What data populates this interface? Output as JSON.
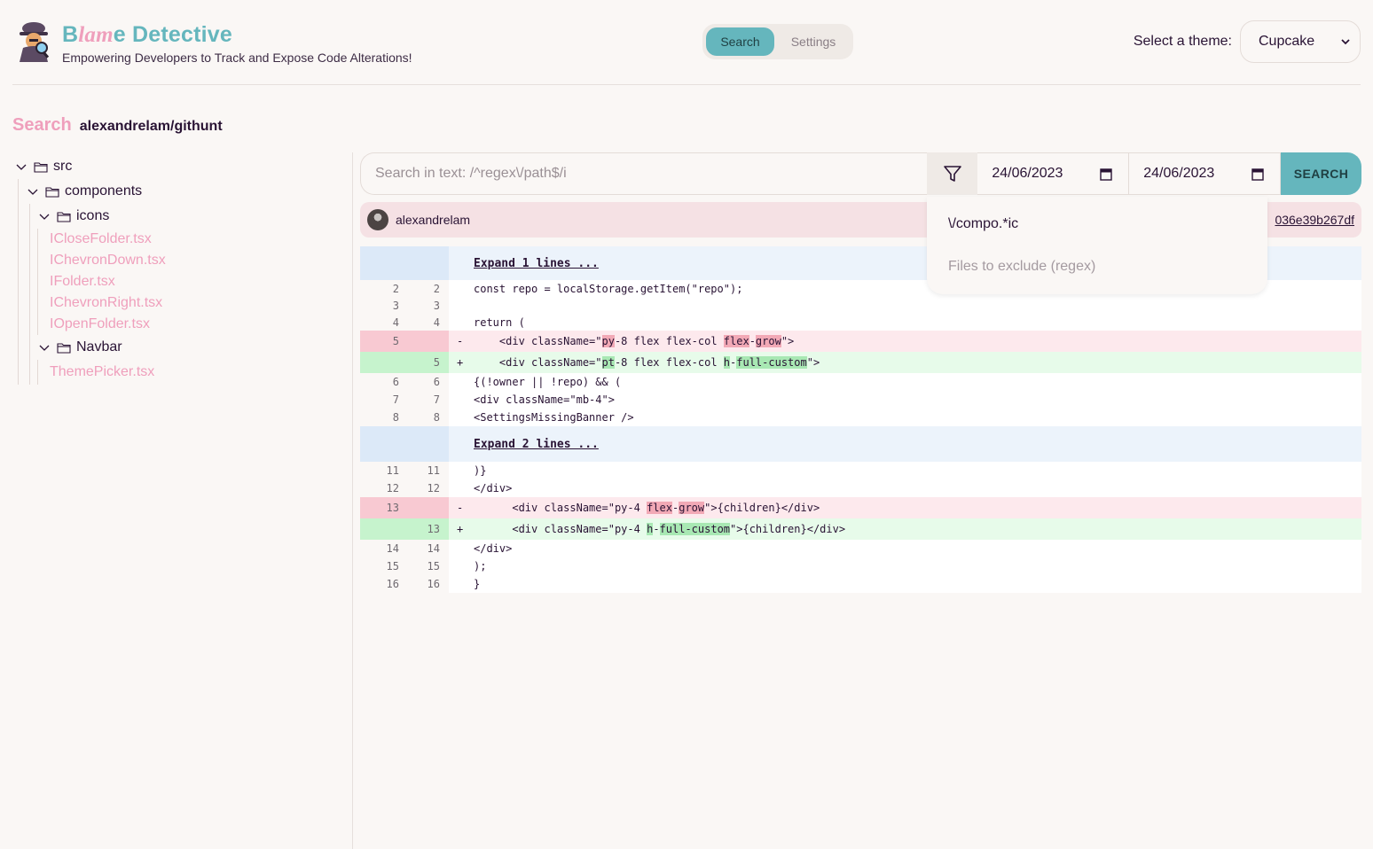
{
  "header": {
    "brand_title_parts": [
      "B",
      "lam",
      "e Detective"
    ],
    "subtitle": "Empowering Developers to Track and Expose Code Alterations!",
    "tabs": [
      {
        "label": "Search",
        "active": true
      },
      {
        "label": "Settings",
        "active": false
      }
    ],
    "theme_label": "Select a theme:",
    "theme_value": "Cupcake"
  },
  "search": {
    "heading": "Search",
    "repo": "alexandrelam/githunt",
    "placeholder": "Search in text: /^regex\\/path$/i",
    "date_from": "24/06/2023",
    "date_to": "24/06/2023",
    "button": "SEARCH"
  },
  "filter_panel": {
    "include_value": "\\/compo.*ic",
    "exclude_placeholder": "Files to exclude (regex)"
  },
  "tree": {
    "root": "src",
    "components": "components",
    "icons_folder": "icons",
    "icons": [
      "ICloseFolder.tsx",
      "IChevronDown.tsx",
      "IFolder.tsx",
      "IChevronRight.tsx",
      "IOpenFolder.tsx"
    ],
    "navbar_folder": "Navbar",
    "navbar_files": [
      "ThemePicker.tsx"
    ]
  },
  "commit": {
    "author": "alexandrelam",
    "hash": "036e39b267df"
  },
  "diff": {
    "expand1": "Expand 1 lines ...",
    "expand2": "Expand 2 lines ...",
    "block1": [
      {
        "type": "ctx",
        "old": "2",
        "new": "2",
        "code": "const repo = localStorage.getItem(\"repo\");"
      },
      {
        "type": "ctx",
        "old": "3",
        "new": "3",
        "code": ""
      },
      {
        "type": "ctx",
        "old": "4",
        "new": "4",
        "code": "return ("
      }
    ],
    "del1": {
      "old": "5",
      "mark": "-",
      "pre": "    <div className=\"",
      "h1": "py",
      "mid": "-8 flex flex-col ",
      "h2": "flex",
      "dash": "-",
      "h3": "grow",
      "post": "\">"
    },
    "add1": {
      "new": "5",
      "mark": "+",
      "pre": "    <div className=\"",
      "h1": "pt",
      "mid": "-8 flex flex-col ",
      "h2": "h",
      "dash": "-",
      "h3": "full-custom",
      "post": "\">"
    },
    "block2": [
      {
        "type": "ctx",
        "old": "6",
        "new": "6",
        "code": "{(!owner || !repo) && ("
      },
      {
        "type": "ctx",
        "old": "7",
        "new": "7",
        "code": "<div className=\"mb-4\">"
      },
      {
        "type": "ctx",
        "old": "8",
        "new": "8",
        "code": "<SettingsMissingBanner />"
      }
    ],
    "block3": [
      {
        "type": "ctx",
        "old": "11",
        "new": "11",
        "code": ")}"
      },
      {
        "type": "ctx",
        "old": "12",
        "new": "12",
        "code": "</div>"
      }
    ],
    "del2": {
      "old": "13",
      "mark": "-",
      "pre": "      <div className=\"py-4 ",
      "h2": "flex",
      "dash": "-",
      "h3": "grow",
      "post": "\">{children}</div>"
    },
    "add2": {
      "new": "13",
      "mark": "+",
      "pre": "      <div className=\"py-4 ",
      "h2": "h",
      "dash": "-",
      "h3": "full-custom",
      "post": "\">{children}</div>"
    },
    "block4": [
      {
        "type": "ctx",
        "old": "14",
        "new": "14",
        "code": "</div>"
      },
      {
        "type": "ctx",
        "old": "15",
        "new": "15",
        "code": ");"
      },
      {
        "type": "ctx",
        "old": "16",
        "new": "16",
        "code": "}"
      }
    ]
  }
}
